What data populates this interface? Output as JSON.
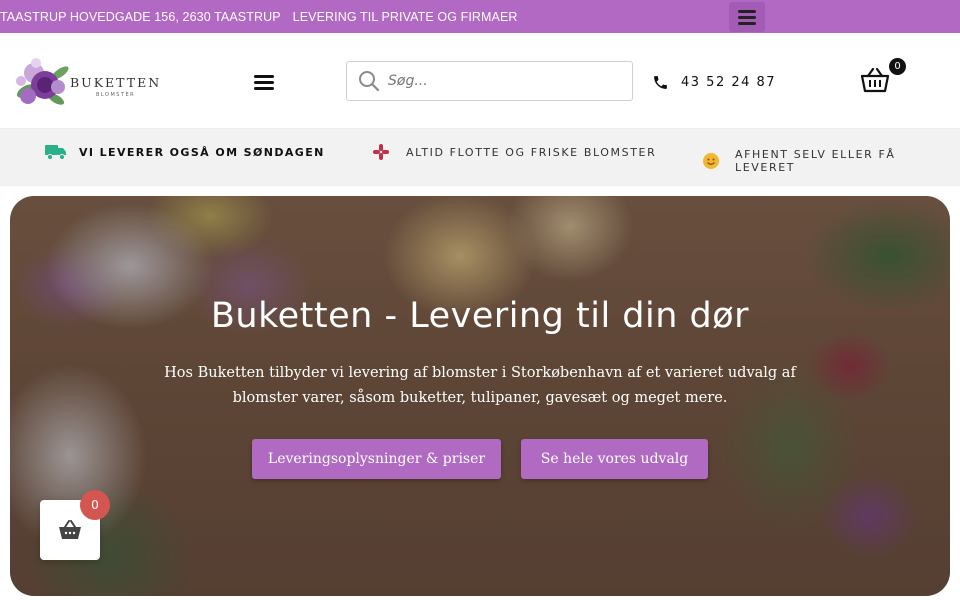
{
  "topbar": {
    "address": "TAASTRUP HOVEDGADE 156, 2630 TAASTRUP",
    "delivery": "LEVERING TIL PRIVATE OG FIRMAER",
    "menu_icon": "hamburger-icon",
    "background": "#b269c4"
  },
  "header": {
    "logo": {
      "wordmark": "BUKETTEN",
      "subtitle": "BLOMSTER"
    },
    "search": {
      "placeholder": "Søg...",
      "value": ""
    },
    "phone": "43 52 24 87",
    "cart_count": "0"
  },
  "usps": [
    {
      "icon": "truck-icon",
      "label": "VI LEVERER OGSÅ OM SØNDAGEN"
    },
    {
      "icon": "flower-icon",
      "label": "ALTID FLOTTE OG FRISKE BLOMSTER"
    },
    {
      "icon": "smiley-icon",
      "label": "AFHENT SELV ELLER FÅ LEVERET"
    }
  ],
  "hero": {
    "title": "Buketten - Levering til din dør",
    "text": "Hos Buketten tilbyder vi levering af blomster i Storkøbenhavn af et varieret udvalg af blomster varer, såsom buketter, tulipaner, gavesæt og meget mere.",
    "buttons": [
      {
        "label": "Leveringsoplysninger & priser"
      },
      {
        "label": "Se hele vores udvalg"
      }
    ]
  },
  "floating_cart": {
    "count": "0",
    "icon": "basket-icon"
  },
  "colors": {
    "accent": "#b06ac2",
    "badge": "#d35650",
    "usp_bg": "#f2f2f2"
  }
}
